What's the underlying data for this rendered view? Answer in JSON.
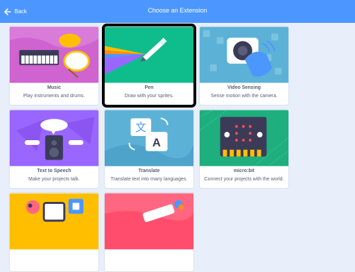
{
  "header": {
    "back_label": "Back",
    "title": "Choose an Extension",
    "color": "#4c97ff"
  },
  "extensions": [
    {
      "name": "Music",
      "description": "Play instruments and drums.",
      "icon": "music-icon"
    },
    {
      "name": "Pen",
      "description": "Draw with your sprites.",
      "icon": "pen-icon",
      "selected": true
    },
    {
      "name": "Video Sensing",
      "description": "Sense motion with the camera.",
      "icon": "video-sensing-icon"
    },
    {
      "name": "Text to Speech",
      "description": "Make your projects talk.",
      "icon": "text-to-speech-icon"
    },
    {
      "name": "Translate",
      "description": "Translate text into many languages.",
      "icon": "translate-icon"
    },
    {
      "name": "micro:bit",
      "description": "Connect your projects with the world.",
      "icon": "microbit-icon"
    },
    {
      "name": "",
      "description": "",
      "icon": "robotics-icon"
    },
    {
      "name": "",
      "description": "",
      "icon": "makey-makey-icon"
    }
  ]
}
